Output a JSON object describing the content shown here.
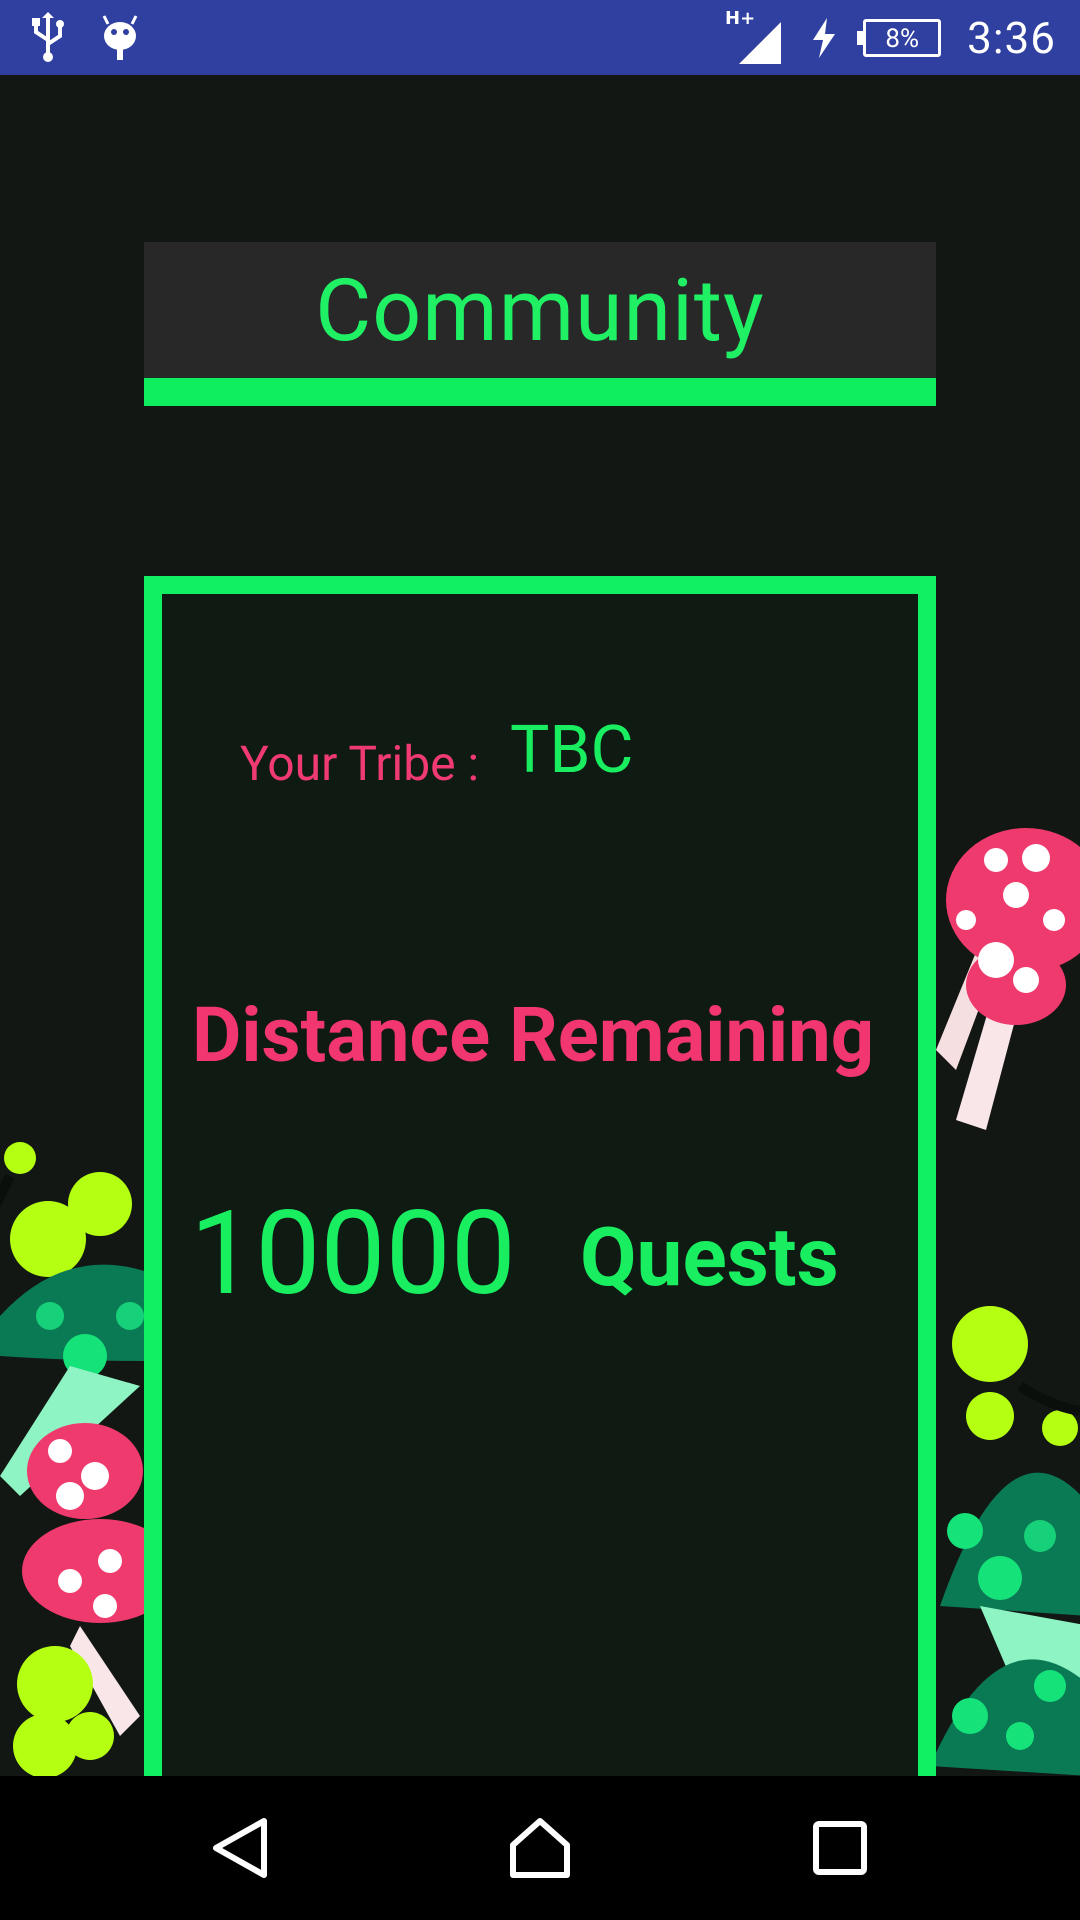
{
  "status_bar": {
    "network": "H+",
    "battery": "8%",
    "time": "3:36"
  },
  "screen": {
    "title": "Community",
    "tribe_label": "Your Tribe :",
    "tribe_value": "TBC",
    "distance_label": "Distance Remaining",
    "distance_value": "10000",
    "distance_unit": "Quests"
  },
  "colors": {
    "status_bar": "#3040a0",
    "background": "#121713",
    "accent_green": "#10f062",
    "accent_pink": "#f2366f",
    "title_box": "#282828"
  },
  "icons": {
    "usb": "usb-icon",
    "android": "android-debug-icon",
    "signal": "signal-icon",
    "charging": "charging-icon",
    "battery": "battery-icon",
    "back": "back-icon",
    "home": "home-icon",
    "recents": "recents-icon"
  }
}
